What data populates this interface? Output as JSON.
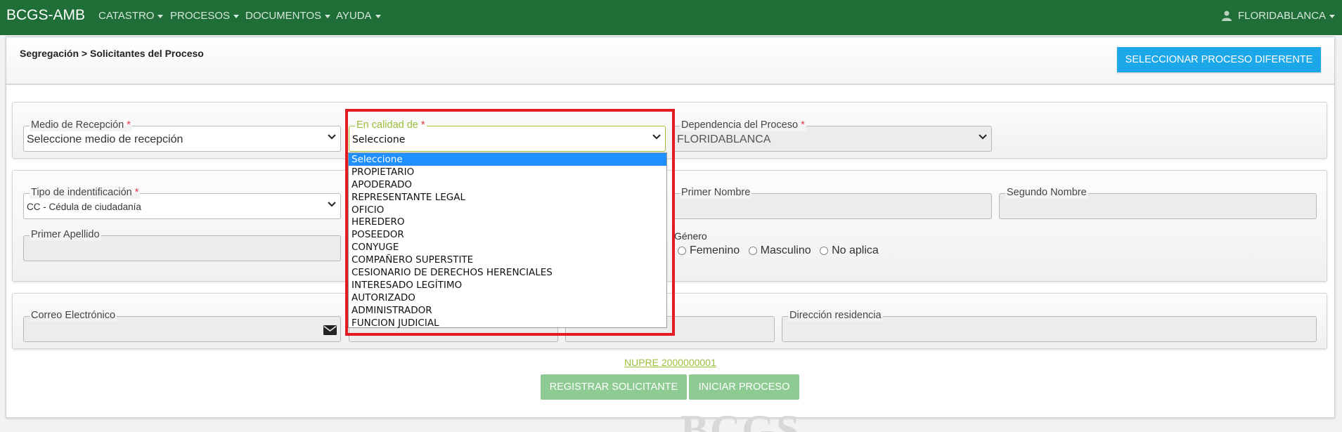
{
  "navbar": {
    "brand": "BCGS-AMB",
    "menu": [
      "CATASTRO",
      "PROCESOS",
      "DOCUMENTOS",
      "AYUDA"
    ],
    "user": "FLORIDABLANCA",
    "user_icon": "user-icon"
  },
  "header": {
    "breadcrumb": "Segregación > Solicitantes del Proceso",
    "select_process_button": "SELECCIONAR PROCESO DIFERENTE"
  },
  "reception": {
    "medio_label": "Medio de Recepción",
    "medio_value": "Seleccione medio de recepción",
    "calidad_label": "En calidad de",
    "calidad_value": "Seleccione",
    "dependencia_label": "Dependencia del Proceso",
    "dependencia_value": "FLORIDABLANCA",
    "required_mark": "*"
  },
  "identification": {
    "tipo_label": "Tipo de indentificación",
    "tipo_value": "CC - Cédula de ciudadanía",
    "primer_nombre_label": "Primer Nombre",
    "segundo_nombre_label": "Segundo Nombre",
    "primer_apellido_label": "Primer Apellido",
    "genero_label": "Género",
    "genero_options": [
      "Femenino",
      "Masculino",
      "No aplica"
    ]
  },
  "contact": {
    "correo_label": "Correo Electrónico",
    "correo_icon": "envelope-icon",
    "direccion_label": "Dirección residencia"
  },
  "footer": {
    "nupre_link": "NUPRE 2000000001",
    "registrar_button": "REGISTRAR SOLICITANTE",
    "iniciar_button": "INICIAR PROCESO"
  },
  "watermark": "BCGS",
  "dropdown": {
    "options": [
      "Seleccione",
      "PROPIETARIO",
      "APODERADO",
      "REPRESENTANTE LEGAL",
      "OFICIO",
      "HEREDERO",
      "POSEEDOR",
      "CONYUGE",
      "COMPAÑERO SUPERSTITE",
      "CESIONARIO DE DERECHOS HERENCIALES",
      "INTERESADO LEGÍTIMO",
      "AUTORIZADO",
      "ADMINISTRADOR",
      "FUNCION JUDICIAL"
    ],
    "selected_index": 0
  },
  "colors": {
    "navbar": "#1f6e37",
    "primary_button": "#1ca7e8",
    "green_button": "#8ecb93",
    "highlight": "#e21b24",
    "selected_option": "#1e90ff",
    "link": "#9abf3c"
  }
}
